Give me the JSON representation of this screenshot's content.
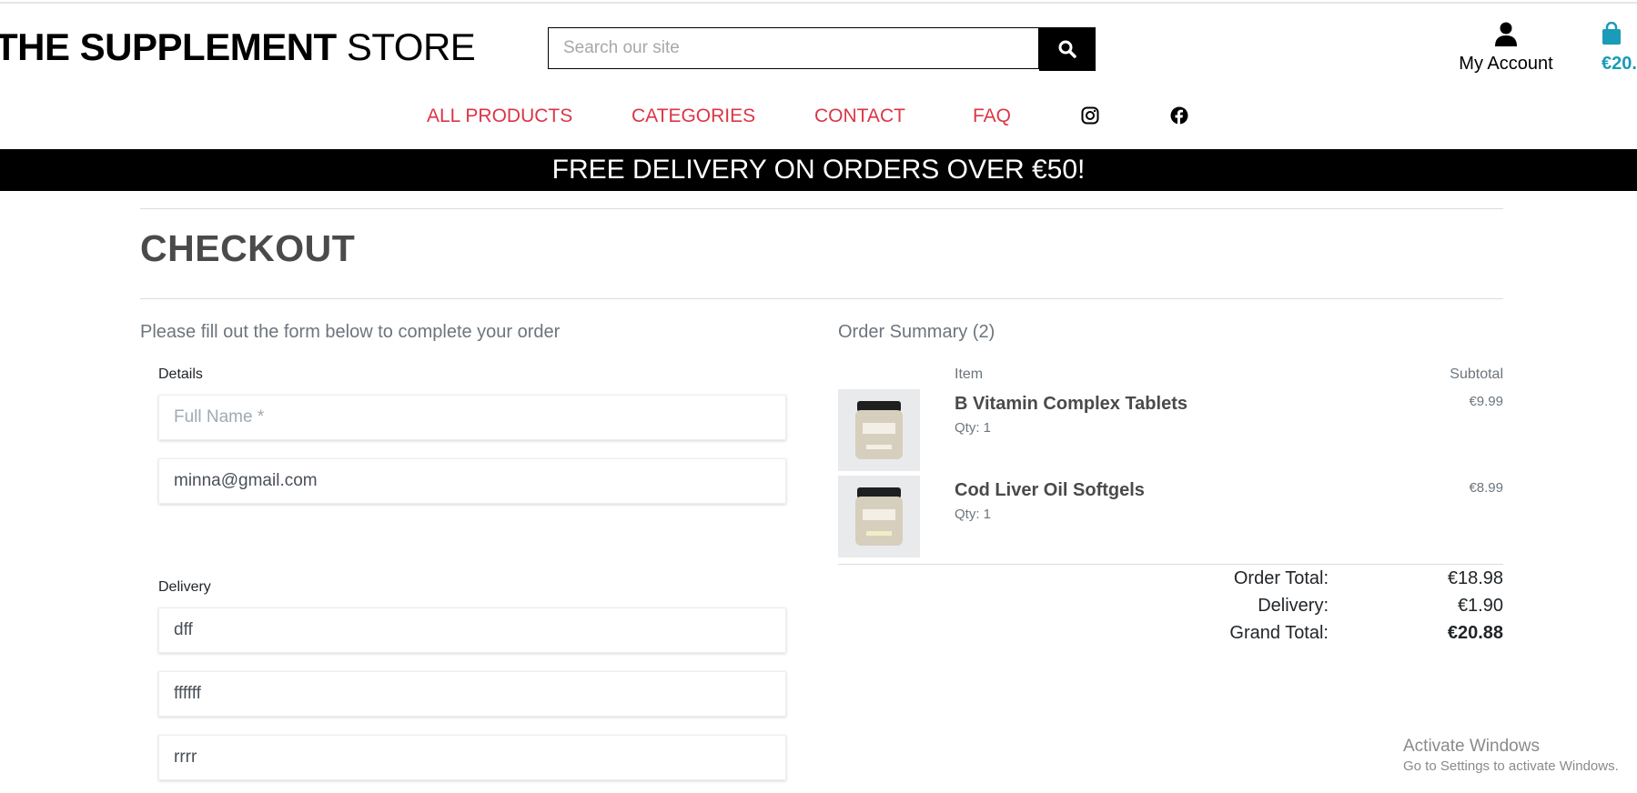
{
  "header": {
    "logo_bold": "THE SUPPLEMENT",
    "logo_light": "STORE",
    "search_placeholder": "Search our site",
    "account_label": "My Account",
    "bag_total": "€20."
  },
  "nav": {
    "items": [
      "ALL PRODUCTS",
      "CATEGORIES",
      "CONTACT",
      "FAQ"
    ],
    "social_icons": [
      "instagram-icon",
      "facebook-icon"
    ],
    "link_color": "#dc3545"
  },
  "banner": {
    "text": "FREE DELIVERY ON ORDERS OVER €50!"
  },
  "checkout": {
    "title": "CHECKOUT",
    "form_intro": "Please fill out the form below to complete your order",
    "details_label": "Details",
    "full_name_placeholder": "Full Name *",
    "email_value": "minna@gmail.com",
    "delivery_label": "Delivery",
    "delivery_fields": [
      "dff",
      "ffffff",
      "rrrr"
    ]
  },
  "summary": {
    "title": "Order Summary (2)",
    "col_item": "Item",
    "col_subtotal": "Subtotal",
    "items": [
      {
        "name": "B Vitamin Complex Tablets",
        "qty": "Qty: 1",
        "subtotal": "€9.99"
      },
      {
        "name": "Cod Liver Oil Softgels",
        "qty": "Qty: 1",
        "subtotal": "€8.99"
      }
    ],
    "order_total_label": "Order Total:",
    "order_total": "€18.98",
    "delivery_label": "Delivery:",
    "delivery": "€1.90",
    "grand_total_label": "Grand Total:",
    "grand_total": "€20.88"
  },
  "watermark": {
    "line1": "Activate Windows",
    "line2": "Go to Settings to activate Windows."
  }
}
